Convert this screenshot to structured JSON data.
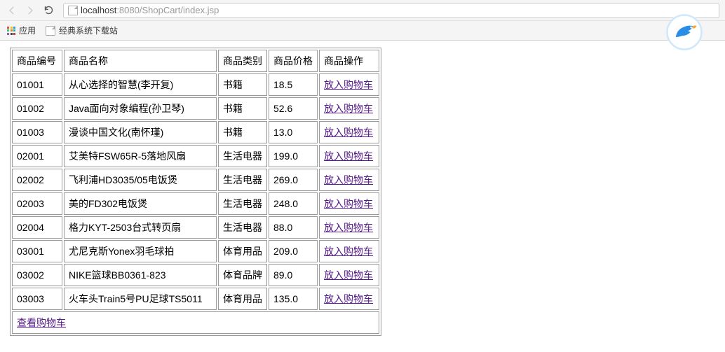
{
  "browser": {
    "url_prefix": "localhost",
    "url_port_path": ":8080/ShopCart/index.jsp"
  },
  "bookmarks": {
    "apps_label": "应用",
    "bookmark1": "经典系统下载站"
  },
  "table": {
    "headers": {
      "id": "商品编号",
      "name": "商品名称",
      "category": "商品类别",
      "price": "商品价格",
      "operation": "商品操作"
    },
    "action_label": "放入购物车",
    "rows": [
      {
        "id": "01001",
        "name": "从心选择的智慧(李开复)",
        "category": "书籍",
        "price": "18.5"
      },
      {
        "id": "01002",
        "name": "Java面向对象编程(孙卫琴)",
        "category": "书籍",
        "price": "52.6"
      },
      {
        "id": "01003",
        "name": "漫谈中国文化(南怀瑾)",
        "category": "书籍",
        "price": "13.0"
      },
      {
        "id": "02001",
        "name": "艾美特FSW65R-5落地风扇",
        "category": "生活电器",
        "price": "199.0"
      },
      {
        "id": "02002",
        "name": "飞利浦HD3035/05电饭煲",
        "category": "生活电器",
        "price": "269.0"
      },
      {
        "id": "02003",
        "name": "美的FD302电饭煲",
        "category": "生活电器",
        "price": "248.0"
      },
      {
        "id": "02004",
        "name": "格力KYT-2503台式转页扇",
        "category": "生活电器",
        "price": "88.0"
      },
      {
        "id": "03001",
        "name": "尤尼克斯Yonex羽毛球拍",
        "category": "体育用品",
        "price": "209.0"
      },
      {
        "id": "03002",
        "name": "NIKE篮球BB0361-823",
        "category": "体育品牌",
        "price": "89.0"
      },
      {
        "id": "03003",
        "name": "火车头Train5号PU足球TS5011",
        "category": "体育用品",
        "price": "135.0"
      }
    ],
    "view_cart_label": "查看购物车"
  }
}
